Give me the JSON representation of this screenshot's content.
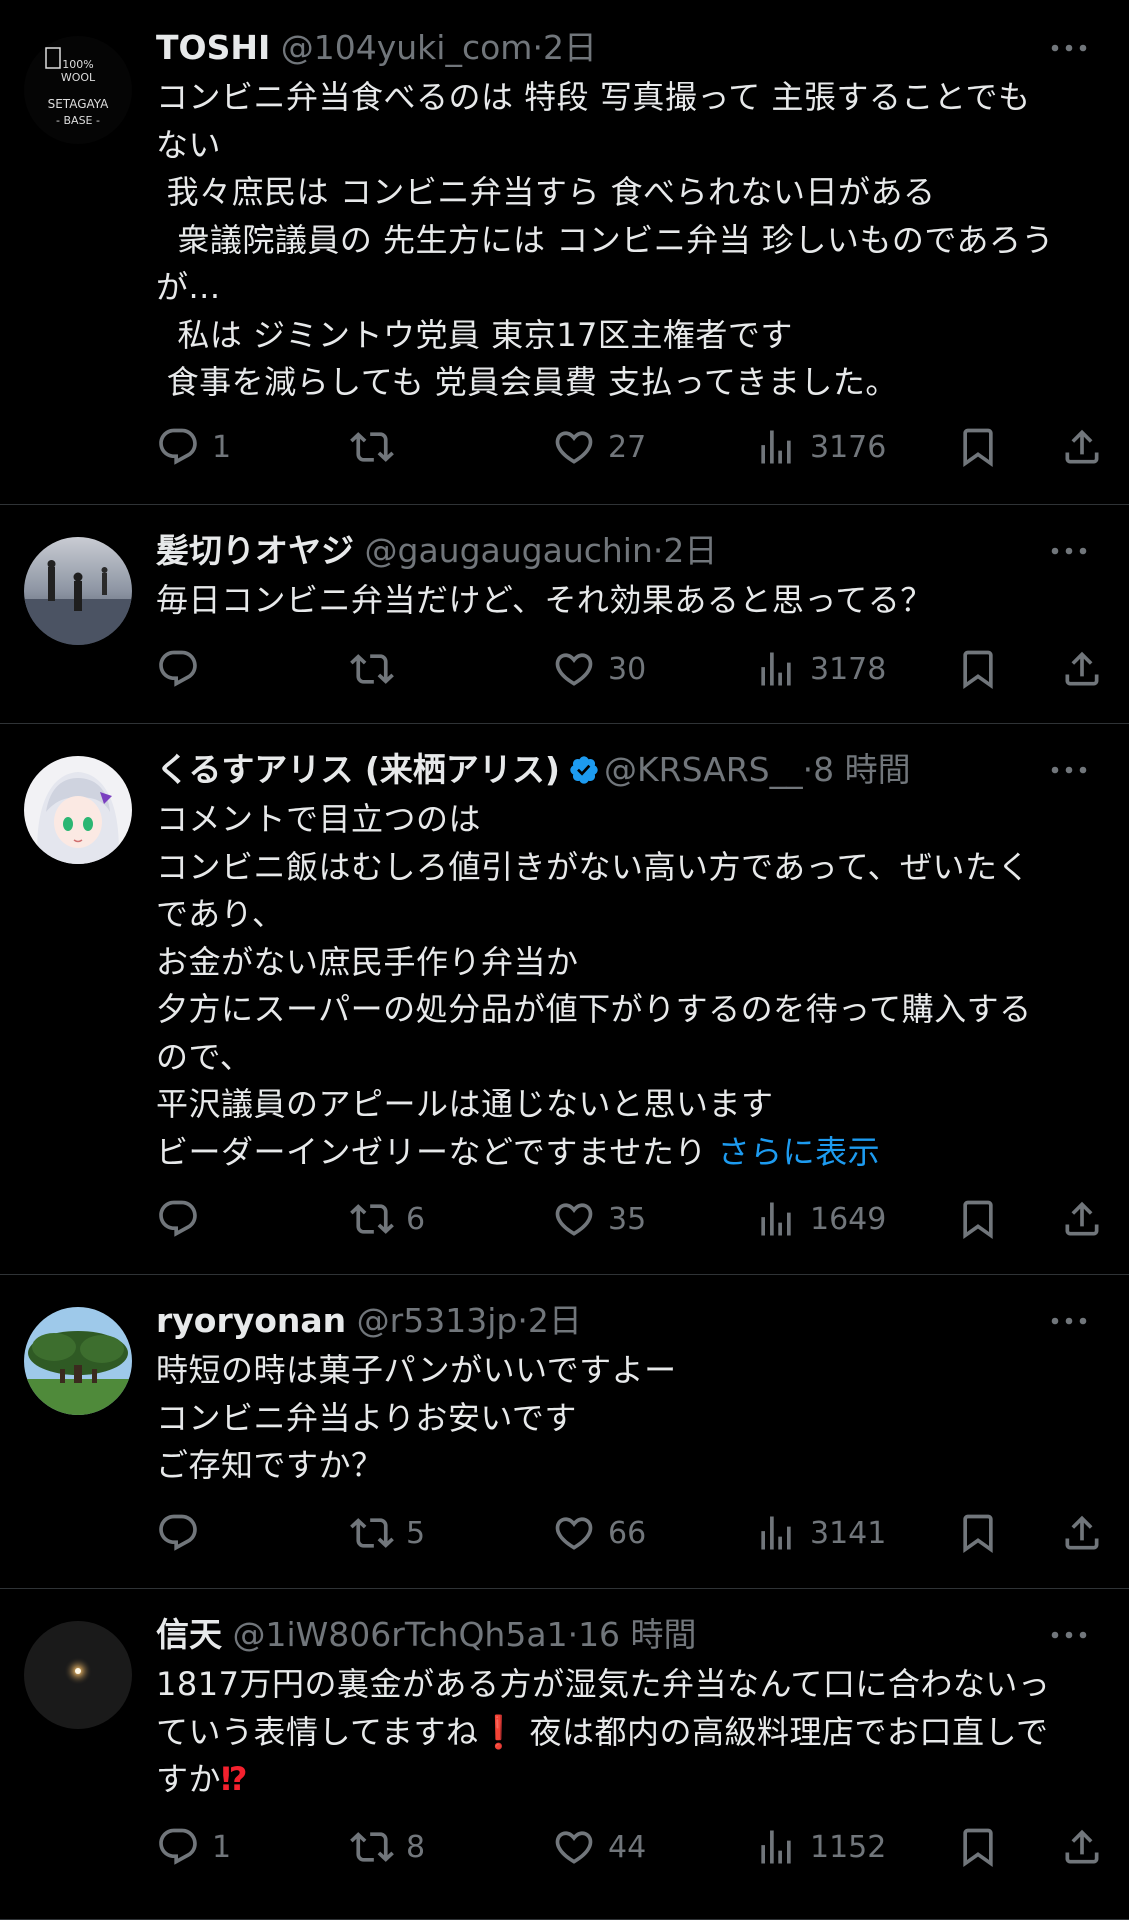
{
  "tweets": [
    {
      "name": "TOSHI",
      "handle": "@104yuki_com",
      "sep": "·",
      "time": "2日",
      "verified": false,
      "lines": [
        "コンビニ弁当食べるのは 特段 写真撮って 主張することでも",
        "ない",
        " 我々庶民は コンビニ弁当すら 食べられない日がある",
        "  衆議院議員の 先生方には コンビニ弁当 珍しいものであろう",
        "が...",
        "  私は ジミントウ党員 東京17区主権者です",
        " 食事を減らしても 党員会員費 支払ってきました。"
      ],
      "replies": "1",
      "retweets": "",
      "likes": "27",
      "views": "3176",
      "avatar_text": [
        "100%",
        "WOOL",
        "SETAGAYA",
        "- BASE -"
      ]
    },
    {
      "name": "髪切りオヤジ",
      "handle": "@gaugaugauchin",
      "sep": "·",
      "time": "2日",
      "verified": false,
      "lines": [
        "毎日コンビニ弁当だけど、それ効果あると思ってる？"
      ],
      "replies": "",
      "retweets": "",
      "likes": "30",
      "views": "3178"
    },
    {
      "name": "くるすアリス (来栖アリス)",
      "handle": "@KRSARS__",
      "sep": "·",
      "time": "8 時間",
      "verified": true,
      "lines": [
        "コメントで目立つのは",
        "コンビニ飯はむしろ値引きがない高い方であって、ぜいたく",
        "であり、",
        "お金がない庶民手作り弁当か",
        "夕方にスーパーの処分品が値下がりするのを待って購入する",
        "ので、",
        "平沢議員のアピールは通じないと思います",
        "ビーダーインゼリーなどですませたり "
      ],
      "show_more": "さらに表示",
      "replies": "",
      "retweets": "6",
      "likes": "35",
      "views": "1649"
    },
    {
      "name": "ryoryonan",
      "handle": "@r5313jp",
      "sep": "·",
      "time": "2日",
      "verified": false,
      "lines": [
        "時短の時は菓子パンがいいですよー",
        "コンビニ弁当よりお安いです",
        "ご存知ですか？"
      ],
      "replies": "",
      "retweets": "5",
      "likes": "66",
      "views": "3141"
    },
    {
      "name": "信天",
      "handle": "@1iW806rTchQh5a1",
      "sep": "·",
      "time": "16 時間",
      "verified": false,
      "line1": "1817万円の裏金がある方が湿気た弁当なんて口に合わないっ",
      "line2a": "ていう表情してますね",
      "emoji1": "❗",
      "line2b": " 夜は都内の高級料理店でお口直しで",
      "line3a": "すか",
      "emoji2": "⁉",
      "replies": "1",
      "retweets": "8",
      "likes": "44",
      "views": "1152"
    }
  ],
  "icons": {
    "reply": "reply-icon",
    "retweet": "retweet-icon",
    "like": "heart-icon",
    "views": "views-icon",
    "bookmark": "bookmark-icon",
    "share": "share-icon",
    "more": "more-icon",
    "verified": "verified-badge-icon"
  },
  "colors": {
    "background": "#000000",
    "text": "#e7e9ea",
    "muted": "#71767b",
    "link": "#1d9bf0",
    "divider": "#2f3336",
    "verified": "#1d9bf0"
  }
}
